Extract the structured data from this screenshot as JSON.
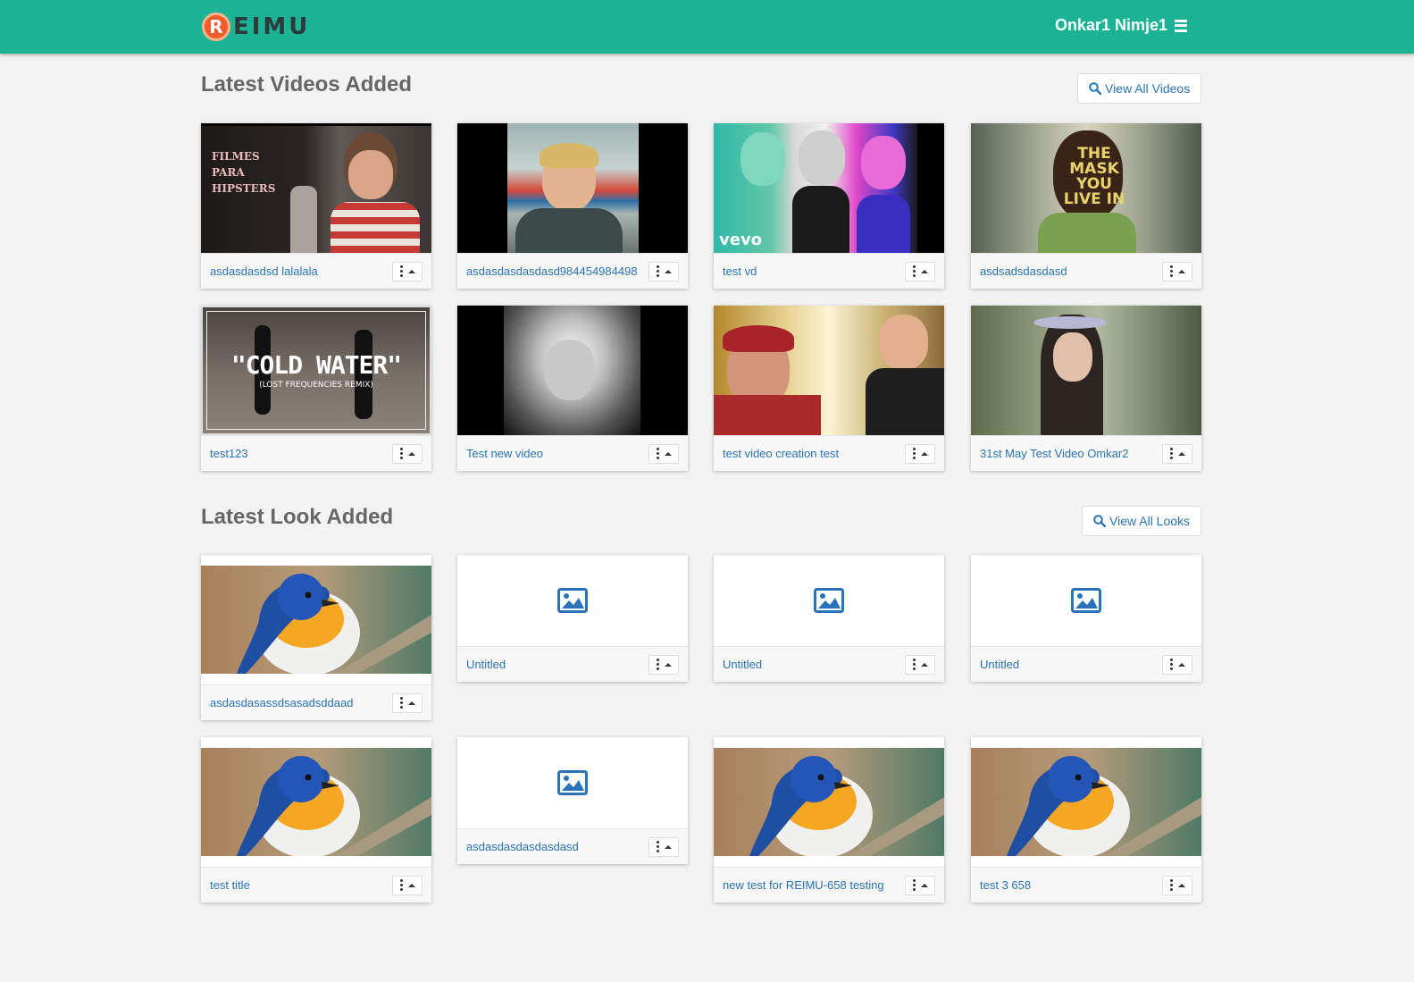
{
  "app": {
    "logo_letter": "R",
    "logo_text": "EIMU",
    "user_name": "Onkar1 Nimje1",
    "brand_color": "#1bb394",
    "link_color": "#2a73b8"
  },
  "videos": {
    "title": "Latest Videos Added",
    "view_all_label": "View All Videos",
    "items": [
      {
        "title": "asdasdasdsd lalalala",
        "thumb_text": "FILMES PARA HIPSTERS"
      },
      {
        "title": "asdasdasdasdasd984454984498"
      },
      {
        "title": "test vd",
        "thumb_text": "vevo"
      },
      {
        "title": "asdsadsdasdasd",
        "thumb_text": "THE MASK YOU LIVE IN"
      },
      {
        "title": "test123",
        "thumb_text": "\"COLD WATER\"",
        "thumb_subtext": "(LOST FREQUENCIES REMIX)"
      },
      {
        "title": "Test new video"
      },
      {
        "title": "test video creation test"
      },
      {
        "title": "31st May Test Video Omkar2"
      }
    ]
  },
  "looks": {
    "title": "Latest Look Added",
    "view_all_label": "View All Looks",
    "items": [
      {
        "title": "asdasdasassdsasadsddaad",
        "image": "bird-photo"
      },
      {
        "title": "Untitled",
        "image": "image-placeholder-icon"
      },
      {
        "title": "Untitled",
        "image": "image-placeholder-icon"
      },
      {
        "title": "Untitled",
        "image": "image-placeholder-icon"
      },
      {
        "title": "test title",
        "image": "bird-photo"
      },
      {
        "title": "asdasdasdasdasdasd",
        "image": "image-placeholder-icon"
      },
      {
        "title": "new test for REIMU-658 testing",
        "image": "bird-photo"
      },
      {
        "title": "test 3 658",
        "image": "bird-photo"
      }
    ]
  },
  "icons": {
    "search": "search-icon",
    "menu": "hamburger-menu-icon",
    "kebab": "kebab-menu-icon",
    "caret": "caret-up-icon",
    "placeholder": "image-placeholder-icon"
  }
}
